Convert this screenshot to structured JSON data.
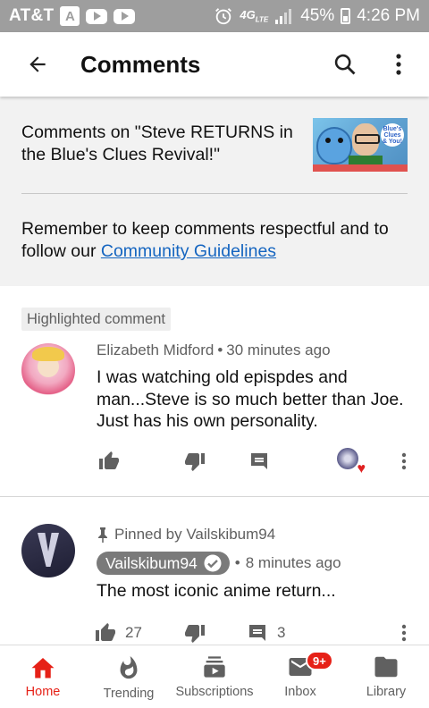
{
  "status_bar": {
    "carrier": "AT&T",
    "network": "4G",
    "network_sub": "LTE",
    "battery": "45%",
    "time": "4:26 PM"
  },
  "app_bar": {
    "title": "Comments"
  },
  "video": {
    "heading": "Comments on \"Steve RETURNS in the Blue's Clues Revival!\"",
    "thumbnail_logo": "Blue's Clues & You!"
  },
  "notice": {
    "text_before": "Remember to keep comments respectful and to follow our ",
    "link_text": "Community Guidelines"
  },
  "highlighted": {
    "label": "Highlighted comment",
    "author": "Elizabeth Midford",
    "time": "30 minutes ago",
    "text": "I was watching old epispdes and man...Steve is so much better than Joe. Just has his own personality."
  },
  "pinned_comment": {
    "pinned_by": "Pinned by Vailskibum94",
    "author": "Vailskibum94",
    "time": "8 minutes ago",
    "text": "The most iconic anime return...",
    "likes": "27",
    "replies": "3"
  },
  "separator_dot": "•",
  "bottom_nav": {
    "items": [
      {
        "label": "Home",
        "icon": "home-icon"
      },
      {
        "label": "Trending",
        "icon": "flame-icon"
      },
      {
        "label": "Subscriptions",
        "icon": "subscriptions-icon"
      },
      {
        "label": "Inbox",
        "icon": "mail-icon",
        "badge": "9+"
      },
      {
        "label": "Library",
        "icon": "folder-icon"
      }
    ]
  },
  "colors": {
    "brand_red": "#e62117",
    "link_blue": "#1565c0",
    "status_bar": "#9e9e9e",
    "header_bg": "#f2f2f2"
  }
}
